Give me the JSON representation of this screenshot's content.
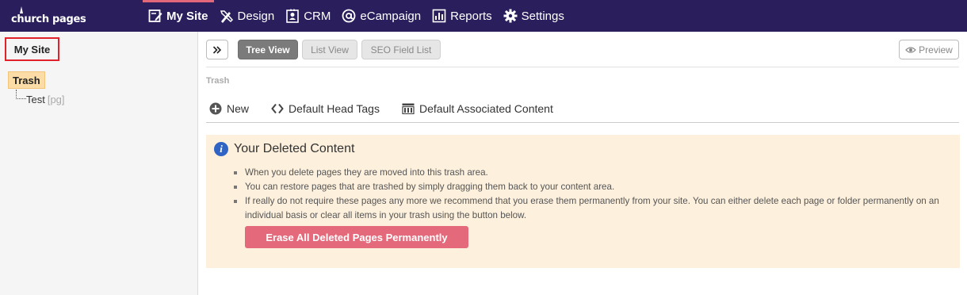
{
  "brand": {
    "logo_text": "church pages",
    "accent": "#e3677a",
    "nav_bg": "#2a1f5c"
  },
  "nav": [
    {
      "label": "My Site",
      "icon": "edit-page-icon",
      "active": true
    },
    {
      "label": "Design",
      "icon": "design-tools-icon"
    },
    {
      "label": "CRM",
      "icon": "contact-card-icon"
    },
    {
      "label": "eCampaign",
      "icon": "at-sign-icon"
    },
    {
      "label": "Reports",
      "icon": "bar-chart-icon"
    },
    {
      "label": "Settings",
      "icon": "gear-icon"
    }
  ],
  "sidebar": {
    "title": "My Site",
    "tree": {
      "root": "Trash",
      "child": "Test",
      "child_type": "[pg]"
    }
  },
  "toolbar": {
    "expand_icon": "double-chevron-right-icon",
    "views": [
      "Tree View",
      "List View",
      "SEO Field List"
    ],
    "active_view": "Tree View",
    "preview_label": "Preview"
  },
  "breadcrumb": "Trash",
  "actions": [
    {
      "label": "New",
      "icon": "plus-circle-icon"
    },
    {
      "label": "Default Head Tags",
      "icon": "code-brackets-icon"
    },
    {
      "label": "Default Associated Content",
      "icon": "columns-icon"
    }
  ],
  "notice": {
    "title": "Your Deleted Content",
    "items": [
      "When you delete pages they are moved into this trash area.",
      "You can restore pages that are trashed by simply dragging them back to your content area.",
      "If really do not require these pages any more we recommend that you erase them permanently from your site. You can either delete each page or folder permanently on an individual basis or clear all items in your trash using the button below."
    ],
    "button_label": "Erase All Deleted Pages Permanently",
    "bg_color": "#fdf0dc",
    "button_color": "#e4697a"
  }
}
